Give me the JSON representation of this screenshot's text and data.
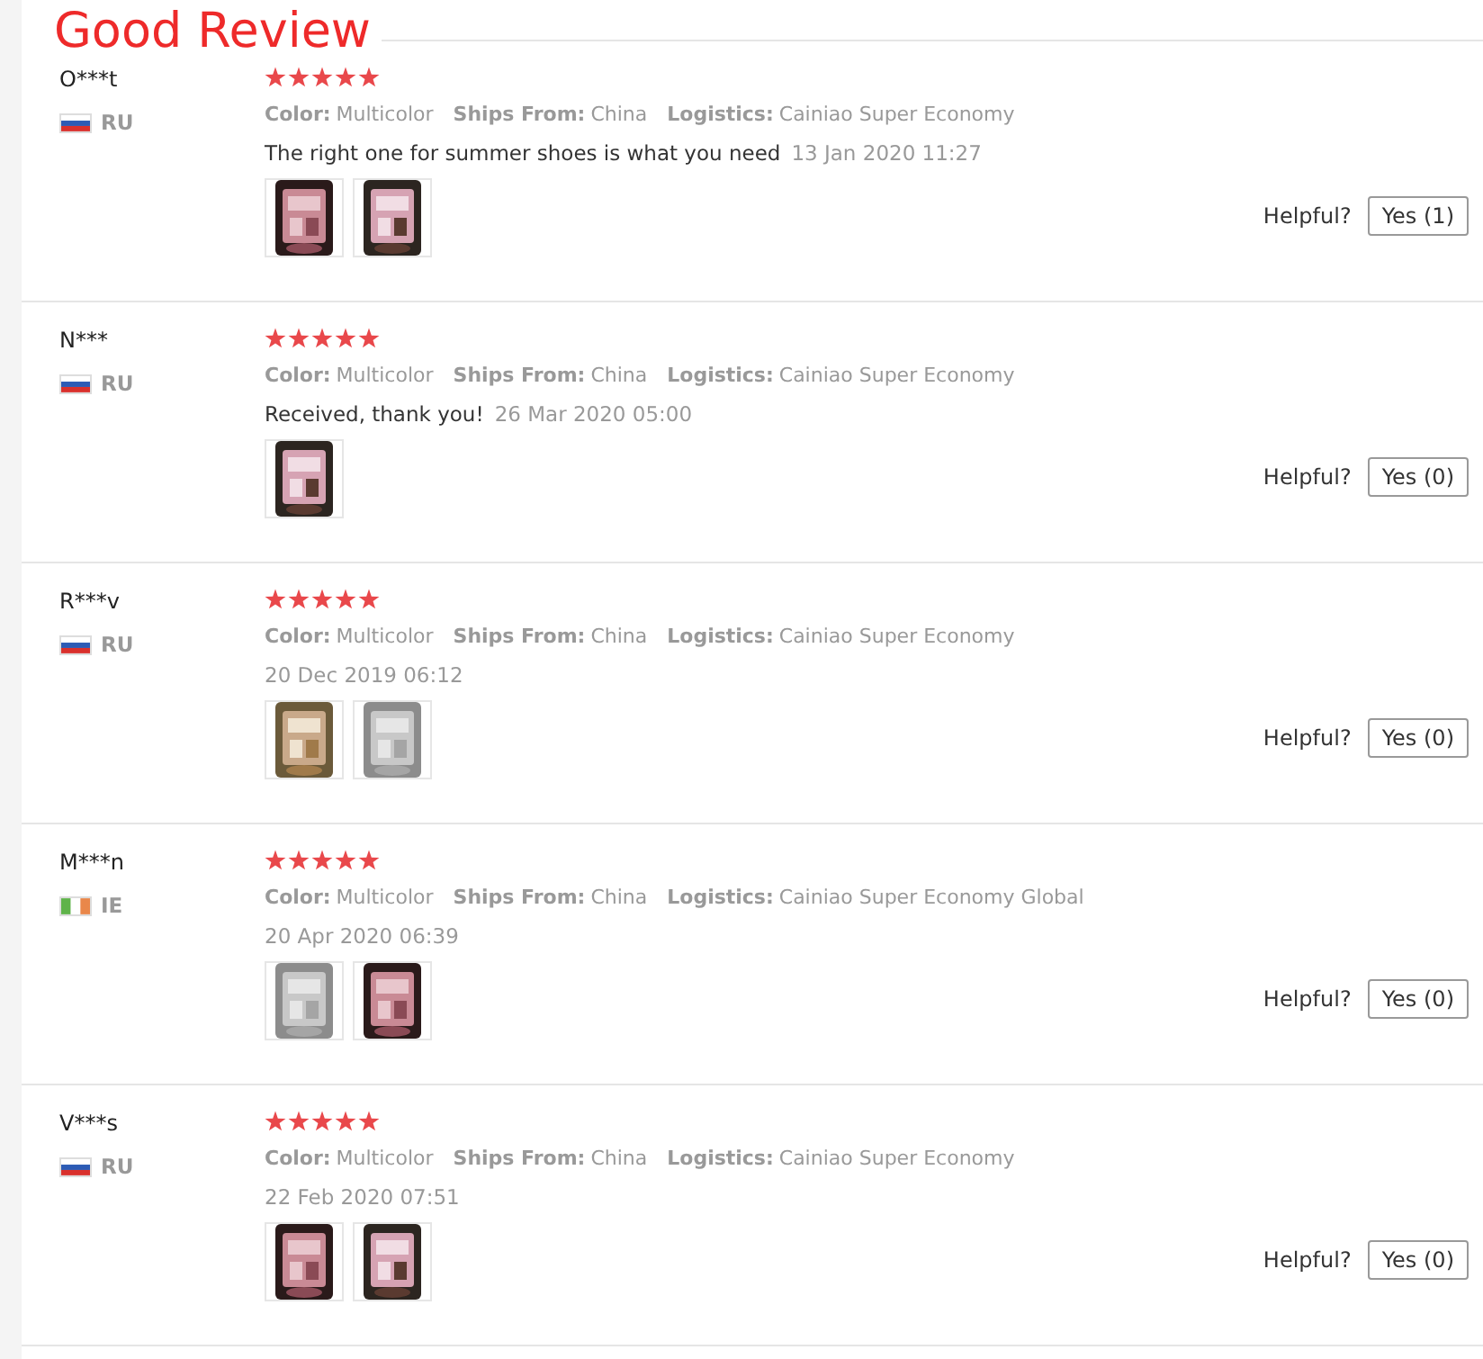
{
  "overlay_title": "Good Review",
  "reviews": [
    {
      "name": "O***t",
      "country": "RU",
      "flag": {
        "kind": "ru"
      },
      "stars": 5,
      "attributes": [
        {
          "label": "Color:",
          "value": "Multicolor"
        },
        {
          "label": "Ships From:",
          "value": "China"
        },
        {
          "label": "Logistics:",
          "value": "Cainiao Super Economy"
        }
      ],
      "comment": "The right one for summer shoes is what you need",
      "date": "13 Jan 2020 11:27",
      "photos": [
        {
          "kind": "picture"
        },
        {
          "kind": "picture"
        }
      ],
      "helpful_label": "Helpful?",
      "helpful_button": "Yes (1)"
    },
    {
      "name": "N***",
      "country": "RU",
      "flag": {
        "kind": "ru"
      },
      "stars": 5,
      "attributes": [
        {
          "label": "Color:",
          "value": "Multicolor"
        },
        {
          "label": "Ships From:",
          "value": "China"
        },
        {
          "label": "Logistics:",
          "value": "Cainiao Super Economy"
        }
      ],
      "comment": "Received, thank you!",
      "date": "26 Mar 2020 05:00",
      "photos": [
        {
          "kind": "picture"
        }
      ],
      "helpful_label": "Helpful?",
      "helpful_button": "Yes (0)"
    },
    {
      "name": "R***v",
      "country": "RU",
      "flag": {
        "kind": "ru"
      },
      "stars": 5,
      "attributes": [
        {
          "label": "Color:",
          "value": "Multicolor"
        },
        {
          "label": "Ships From:",
          "value": "China"
        },
        {
          "label": "Logistics:",
          "value": "Cainiao Super Economy"
        }
      ],
      "date": "20 Dec 2019 06:12",
      "photos": [
        {
          "kind": "picture"
        },
        {
          "kind": "picture"
        }
      ],
      "helpful_label": "Helpful?",
      "helpful_button": "Yes (0)"
    },
    {
      "name": "M***n",
      "country": "IE",
      "flag": {
        "kind": "ie"
      },
      "stars": 5,
      "attributes": [
        {
          "label": "Color:",
          "value": "Multicolor"
        },
        {
          "label": "Ships From:",
          "value": "China"
        },
        {
          "label": "Logistics:",
          "value": "Cainiao Super Economy Global"
        }
      ],
      "date": "20 Apr 2020 06:39",
      "photos": [
        {
          "kind": "picture"
        },
        {
          "kind": "picture"
        }
      ],
      "helpful_label": "Helpful?",
      "helpful_button": "Yes (0)"
    },
    {
      "name": "V***s",
      "country": "RU",
      "flag": {
        "kind": "ru"
      },
      "stars": 5,
      "attributes": [
        {
          "label": "Color:",
          "value": "Multicolor"
        },
        {
          "label": "Ships From:",
          "value": "China"
        },
        {
          "label": "Logistics:",
          "value": "Cainiao Super Economy"
        }
      ],
      "date": "22 Feb 2020 07:51",
      "photos": [
        {
          "kind": "picture"
        },
        {
          "kind": "picture"
        }
      ],
      "helpful_label": "Helpful?",
      "helpful_button": "Yes (0)"
    }
  ]
}
